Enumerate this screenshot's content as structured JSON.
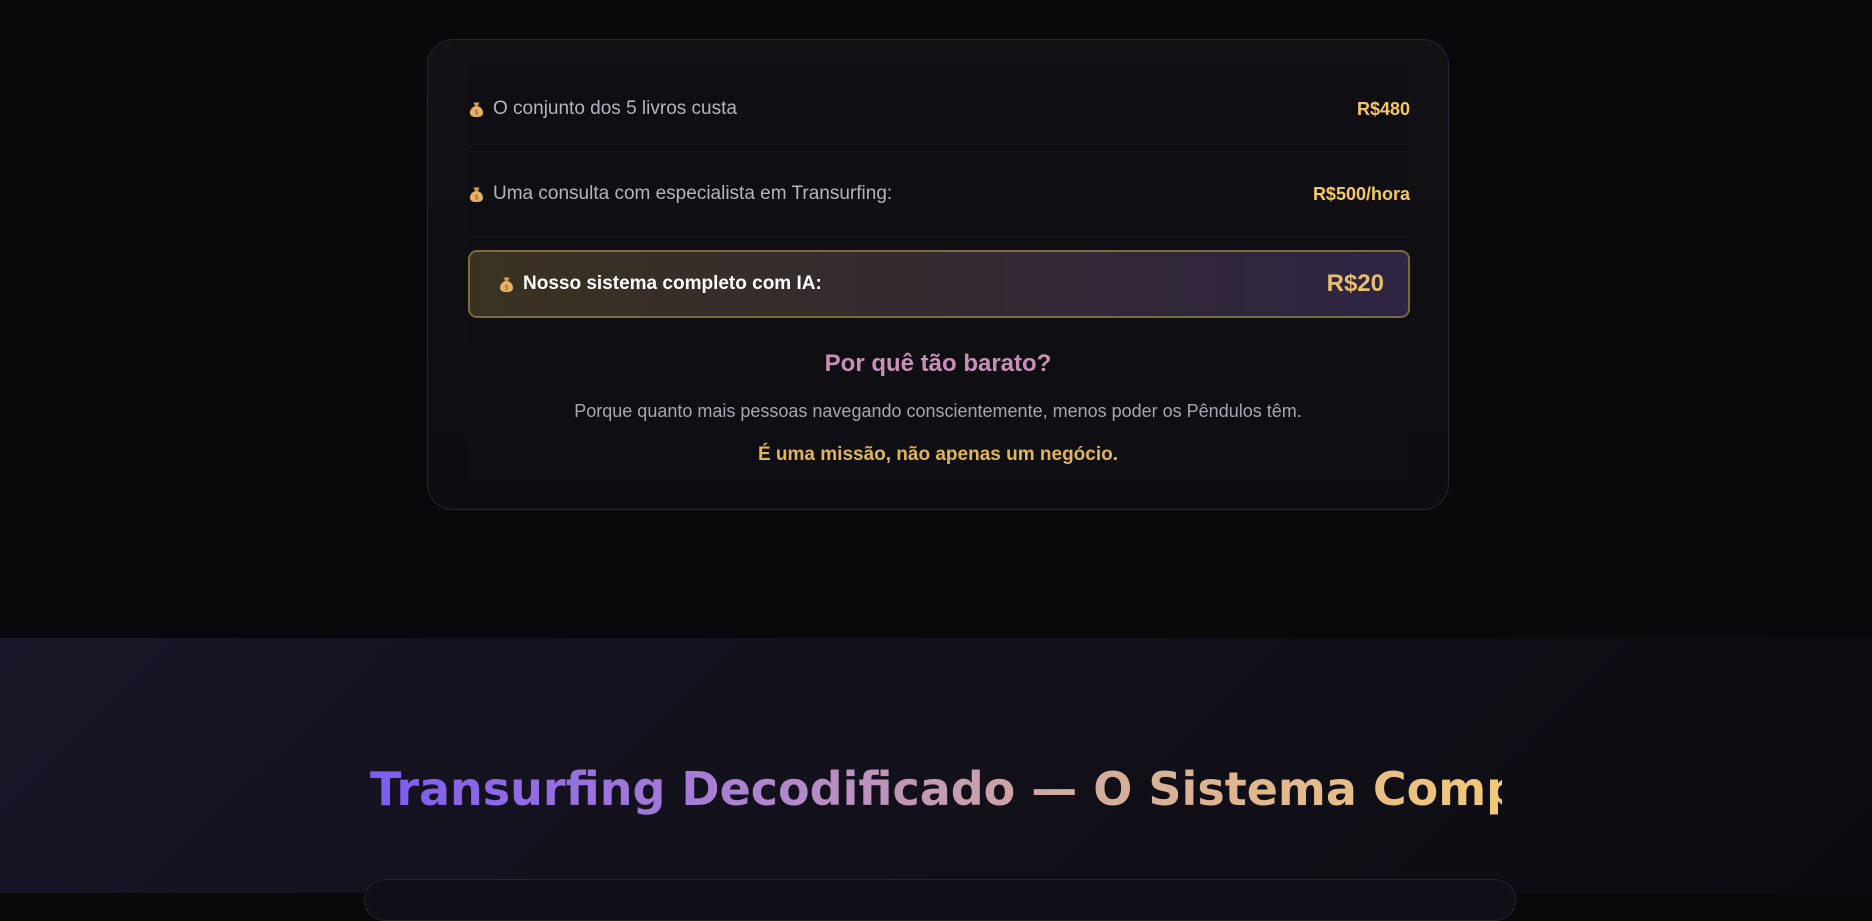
{
  "pricing": {
    "rows": [
      {
        "icon": "money-bag-icon",
        "label": "O conjunto dos 5 livros custa",
        "price": "R$480"
      },
      {
        "icon": "money-bag-icon",
        "label": "Uma consulta com especialista em Transurfing:",
        "price": "R$500/hora"
      }
    ],
    "highlight": {
      "icon": "money-bag-icon",
      "label": "Nosso sistema completo com IA:",
      "price": "R$20"
    },
    "why_title": "Por quê tão barato?",
    "why_text": "Porque quanto mais pessoas navegando conscientemente, menos poder os Pêndulos têm.",
    "mission": "É uma missão, não apenas um negócio."
  },
  "system_section": {
    "title": "Transurfing Decodificado — O Sistema Completo"
  },
  "colors": {
    "price": "#f5c95a",
    "why_title": "#c890b8",
    "mission": "#e2b554",
    "title_gradient": [
      "#7c5cf0",
      "#a87ed4",
      "#d1a9a0",
      "#f1c878"
    ]
  }
}
